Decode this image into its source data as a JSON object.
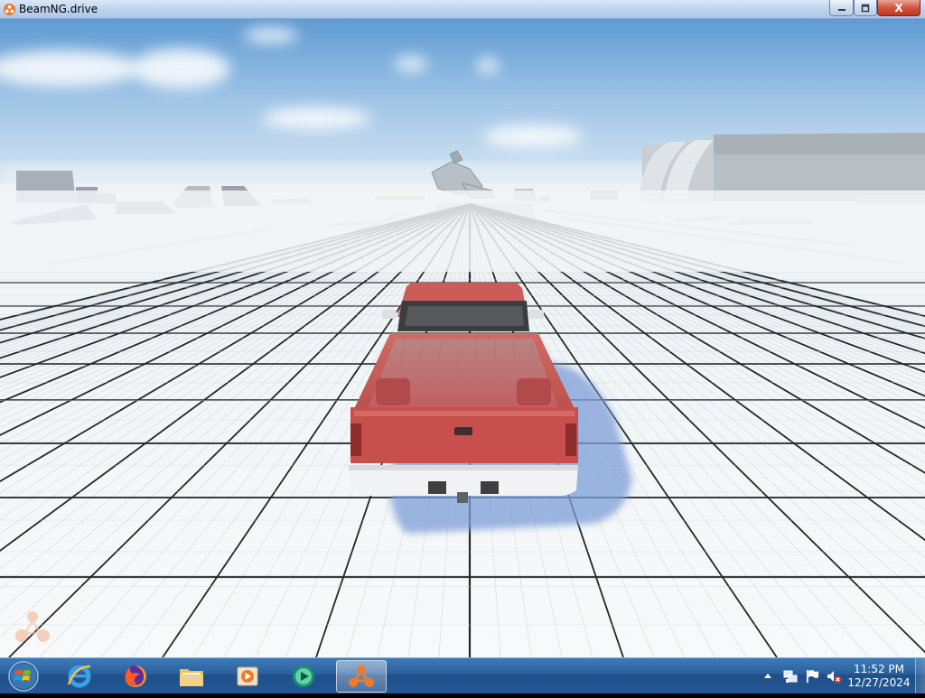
{
  "window": {
    "title": "BeamNG.drive",
    "minimize_icon": "minimize-icon",
    "maximize_icon": "maximize-icon",
    "close_label": "X"
  },
  "game": {
    "logo_icon": "beamng-logo-icon",
    "vehicle_color": "#c65a55",
    "sky_color": "#bcd8ef",
    "ground_color": "#f4f6f7"
  },
  "taskbar": {
    "start_icon": "windows-orb-icon",
    "apps": [
      {
        "name": "Internet Explorer",
        "icon": "internet-explorer-icon",
        "active": false
      },
      {
        "name": "Firefox",
        "icon": "firefox-icon",
        "active": false
      },
      {
        "name": "Windows Explorer",
        "icon": "folder-icon",
        "active": false
      },
      {
        "name": "Media Player",
        "icon": "media-player-icon",
        "active": false
      },
      {
        "name": "Media Center",
        "icon": "media-center-icon",
        "active": false
      },
      {
        "name": "BeamNG.drive",
        "icon": "beamng-icon",
        "active": true
      }
    ],
    "tray": {
      "expand_icon": "tray-expand-icon",
      "icons": [
        "network-icon",
        "action-center-flag-icon",
        "volume-muted-icon"
      ]
    },
    "clock": {
      "time": "11:52 PM",
      "date": "12/27/2024"
    }
  }
}
